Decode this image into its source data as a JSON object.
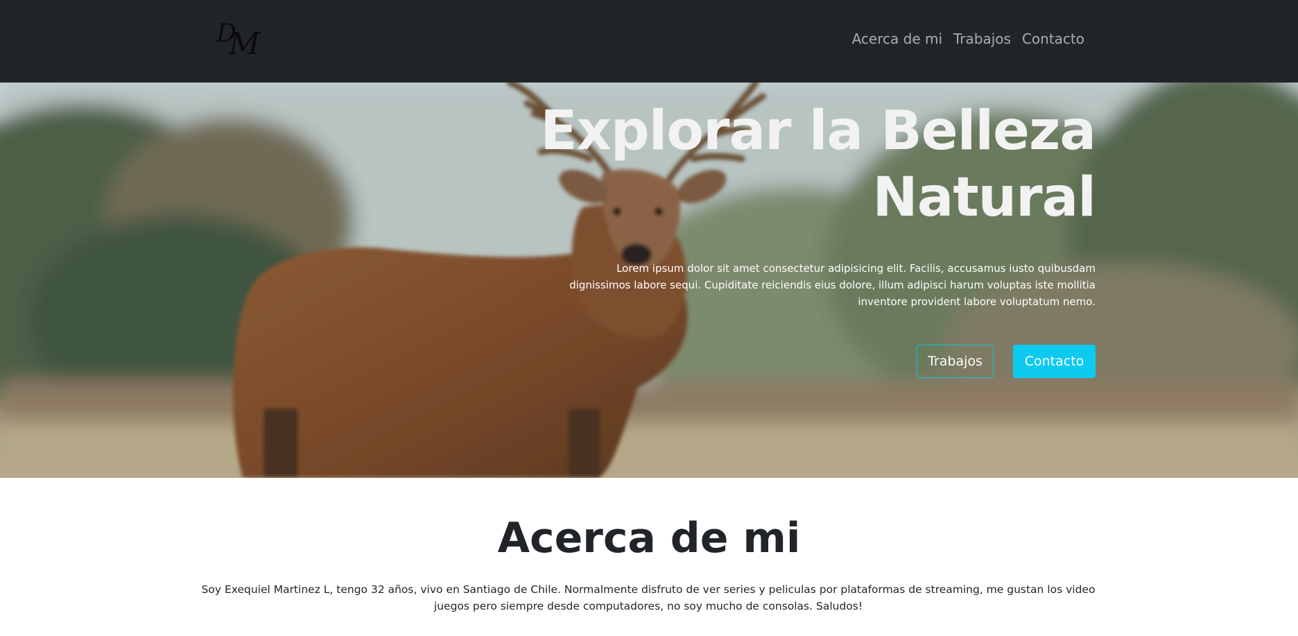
{
  "brand": {
    "logo_text": "DM"
  },
  "nav": {
    "items": [
      {
        "label": "Acerca de mi"
      },
      {
        "label": "Trabajos"
      },
      {
        "label": "Contacto"
      }
    ]
  },
  "hero": {
    "title_line1": "Explorar la Belleza",
    "title_line2": "Natural",
    "text": "Lorem ipsum dolor sit amet consectetur adipisicing elit. Facilis, accusamus iusto quibusdam dignissimos labore sequi. Cupiditate reiciendis eius dolore, illum adipisci harum voluptas iste mollitia inventore provident labore voluptatum nemo.",
    "buttons": [
      {
        "label": "Trabajos",
        "style": "outline"
      },
      {
        "label": "Contacto",
        "style": "solid"
      }
    ],
    "image": "deer-in-forest-background"
  },
  "about": {
    "title": "Acerca de mi",
    "text": "Soy Exequiel Martinez L, tengo 32 años, vivo en Santiago de Chile. Normalmente disfruto de ver series y peliculas por plataformas de streaming, me gustan los video juegos pero siempre desde computadores, no soy mucho de consolas. Saludos!"
  },
  "colors": {
    "navbar_bg": "#212529",
    "accent": "#0dcaf0",
    "text_dark": "#212529"
  }
}
